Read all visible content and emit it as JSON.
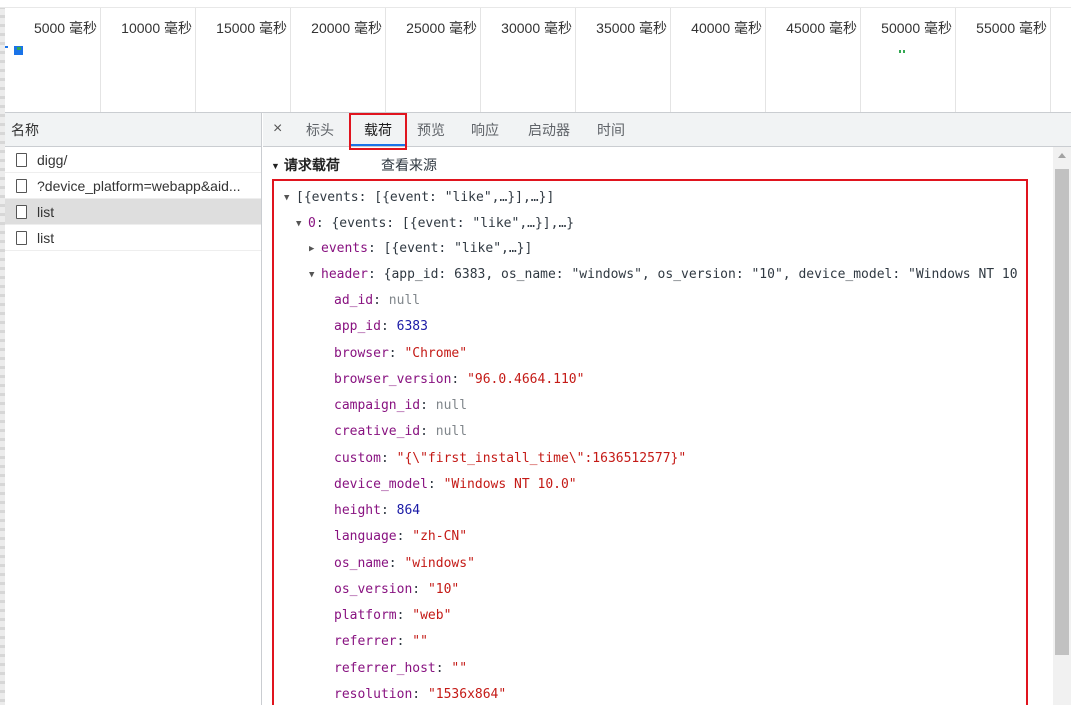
{
  "timeline": {
    "ticks": [
      "5000 毫秒",
      "10000 毫秒",
      "15000 毫秒",
      "20000 毫秒",
      "25000 毫秒",
      "30000 毫秒",
      "35000 毫秒",
      "40000 毫秒",
      "45000 毫秒",
      "50000 毫秒",
      "55000 毫秒"
    ]
  },
  "requests": {
    "header": "名称",
    "items": [
      {
        "name": "digg/",
        "selected": false
      },
      {
        "name": "?device_platform=webapp&aid...",
        "selected": false
      },
      {
        "name": "list",
        "selected": true
      },
      {
        "name": "list",
        "selected": false
      }
    ]
  },
  "detail": {
    "close": "×",
    "tabs": [
      "标头",
      "载荷",
      "预览",
      "响应",
      "启动器",
      "时间"
    ],
    "active_tab": "载荷",
    "section_title": "请求载荷",
    "view_source": "查看来源"
  },
  "payload": {
    "root": "[{events: [{event: \"like\",…}],…}]",
    "item0_key": "0",
    "item0_summary": "{events: [{event: \"like\",…}],…}",
    "events_key": "events",
    "events_summary": "[{event: \"like\",…}]",
    "header_key": "header",
    "header_summary": "{app_id: 6383, os_name: \"windows\", os_version: \"10\", device_model: \"Windows NT 10",
    "fields": [
      {
        "key": "ad_id",
        "value": "null",
        "kind": "nil"
      },
      {
        "key": "app_id",
        "value": "6383",
        "kind": "num"
      },
      {
        "key": "browser",
        "value": "\"Chrome\"",
        "kind": "str"
      },
      {
        "key": "browser_version",
        "value": "\"96.0.4664.110\"",
        "kind": "str"
      },
      {
        "key": "campaign_id",
        "value": "null",
        "kind": "nil"
      },
      {
        "key": "creative_id",
        "value": "null",
        "kind": "nil"
      },
      {
        "key": "custom",
        "value": "\"{\\\"first_install_time\\\":1636512577}\"",
        "kind": "str"
      },
      {
        "key": "device_model",
        "value": "\"Windows NT 10.0\"",
        "kind": "str"
      },
      {
        "key": "height",
        "value": "864",
        "kind": "num"
      },
      {
        "key": "language",
        "value": "\"zh-CN\"",
        "kind": "str"
      },
      {
        "key": "os_name",
        "value": "\"windows\"",
        "kind": "str"
      },
      {
        "key": "os_version",
        "value": "\"10\"",
        "kind": "str"
      },
      {
        "key": "platform",
        "value": "\"web\"",
        "kind": "str"
      },
      {
        "key": "referrer",
        "value": "\"\"",
        "kind": "str"
      },
      {
        "key": "referrer_host",
        "value": "\"\"",
        "kind": "str"
      },
      {
        "key": "resolution",
        "value": "\"1536x864\"",
        "kind": "str"
      }
    ]
  },
  "colors": {
    "highlight_border": "#e0141e",
    "tab_underline": "#1a73e8",
    "key": "#881280",
    "string": "#c41a16",
    "number": "#1a1aa6",
    "null": "#80868b"
  }
}
